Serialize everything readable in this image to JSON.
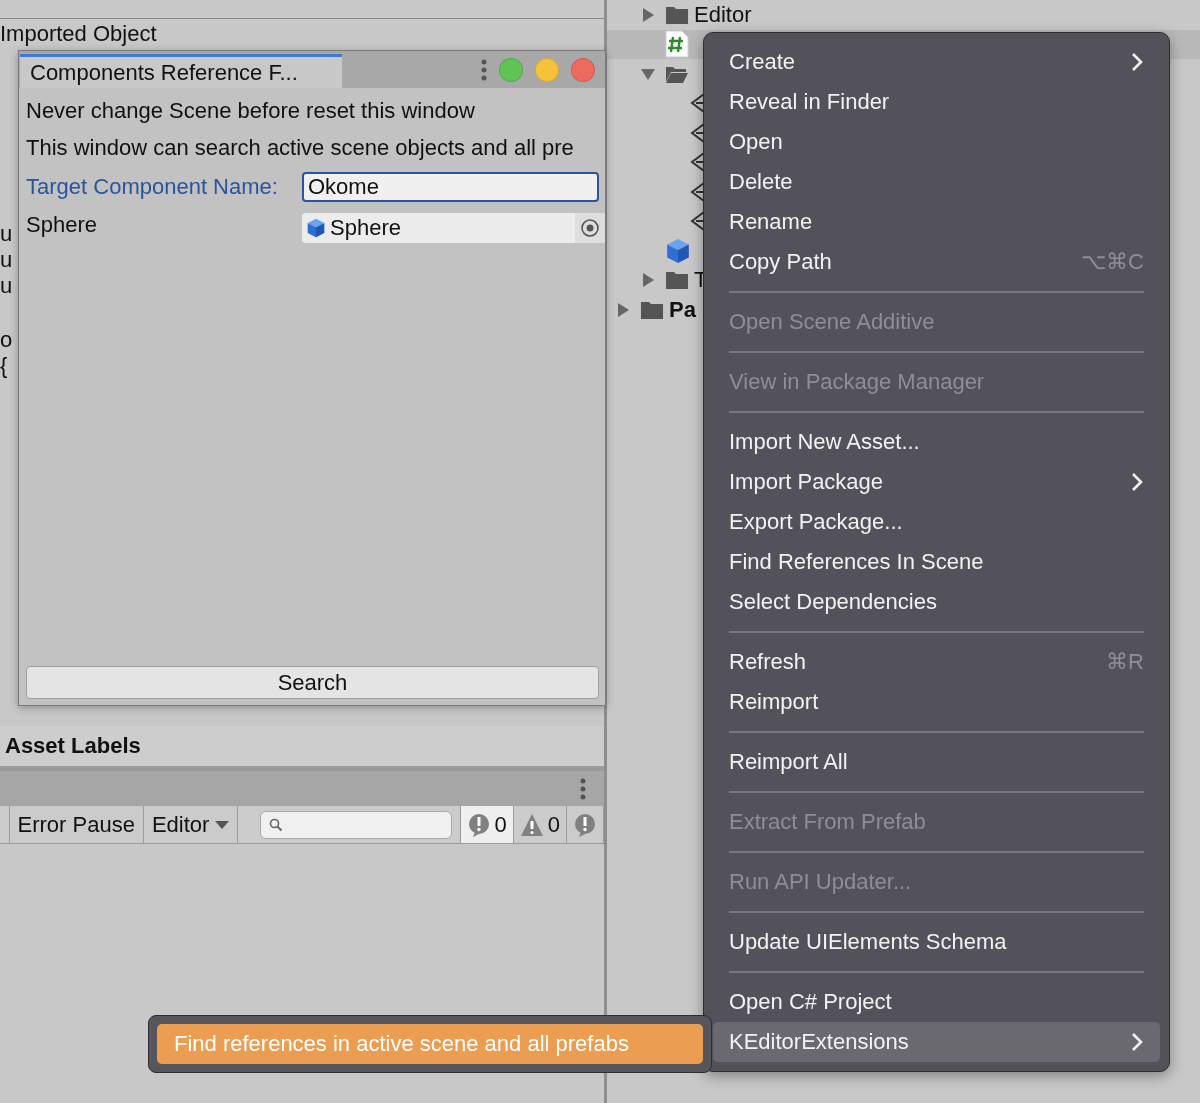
{
  "inspector": {
    "header": "Imported Object",
    "fragments": [
      "u",
      "u",
      "u",
      "o",
      "{"
    ]
  },
  "floating_window": {
    "tab": {
      "label": "Components Reference F...",
      "selected": true
    },
    "lines": [
      "Never change Scene before reset this window",
      "This window can search active scene objects and all pre"
    ],
    "target_field": {
      "label": "Target Component Name:",
      "value": "Okome",
      "focused": true
    },
    "object_field": {
      "label": "Sphere",
      "value": "Sphere"
    },
    "button": "Search"
  },
  "asset_labels": "Asset Labels",
  "console_toolbar": {
    "toggle": "Error Pause",
    "dropdown": "Editor",
    "counters": [
      {
        "kind": "error",
        "count": "0"
      },
      {
        "kind": "warning",
        "count": "0"
      },
      {
        "kind": "error"
      }
    ]
  },
  "project_tree": [
    {
      "kind": "folder",
      "label": "Editor",
      "expanded": false,
      "selected": false
    },
    {
      "kind": "script",
      "selected": true
    },
    {
      "kind": "folder",
      "expanded": true,
      "selected": false,
      "children": [
        {
          "kind": "prefab"
        },
        {
          "kind": "prefab"
        },
        {
          "kind": "prefab"
        },
        {
          "kind": "prefab"
        },
        {
          "kind": "prefab"
        }
      ]
    },
    {
      "kind": "model",
      "selected": false
    },
    {
      "kind": "folder",
      "label": "T",
      "expanded": false,
      "selected": false
    }
  ],
  "project_root": [
    {
      "kind": "folder",
      "label": "Pa",
      "expanded": false,
      "selected": false
    }
  ],
  "context_menu": [
    {
      "kind": "item",
      "label": "Create",
      "submenu": true,
      "disabled": false,
      "selected": false
    },
    {
      "kind": "item",
      "label": "Reveal in Finder",
      "submenu": false,
      "disabled": false,
      "selected": false
    },
    {
      "kind": "item",
      "label": "Open",
      "submenu": false,
      "disabled": false,
      "selected": false
    },
    {
      "kind": "item",
      "label": "Delete",
      "submenu": false,
      "disabled": false,
      "selected": false
    },
    {
      "kind": "item",
      "label": "Rename",
      "submenu": false,
      "disabled": false,
      "selected": false
    },
    {
      "kind": "item",
      "label": "Copy Path",
      "shortcut": "⌥⌘C",
      "submenu": false,
      "disabled": false,
      "selected": false
    },
    {
      "kind": "separator"
    },
    {
      "kind": "item",
      "label": "Open Scene Additive",
      "submenu": false,
      "disabled": true,
      "selected": false
    },
    {
      "kind": "separator"
    },
    {
      "kind": "item",
      "label": "View in Package Manager",
      "submenu": false,
      "disabled": true,
      "selected": false
    },
    {
      "kind": "separator"
    },
    {
      "kind": "item",
      "label": "Import New Asset...",
      "submenu": false,
      "disabled": false,
      "selected": false
    },
    {
      "kind": "item",
      "label": "Import Package",
      "submenu": true,
      "disabled": false,
      "selected": false
    },
    {
      "kind": "item",
      "label": "Export Package...",
      "submenu": false,
      "disabled": false,
      "selected": false
    },
    {
      "kind": "item",
      "label": "Find References In Scene",
      "submenu": false,
      "disabled": false,
      "selected": false
    },
    {
      "kind": "item",
      "label": "Select Dependencies",
      "submenu": false,
      "disabled": false,
      "selected": false
    },
    {
      "kind": "separator"
    },
    {
      "kind": "item",
      "label": "Refresh",
      "shortcut": "⌘R",
      "submenu": false,
      "disabled": false,
      "selected": false
    },
    {
      "kind": "item",
      "label": "Reimport",
      "submenu": false,
      "disabled": false,
      "selected": false
    },
    {
      "kind": "separator"
    },
    {
      "kind": "item",
      "label": "Reimport All",
      "submenu": false,
      "disabled": false,
      "selected": false
    },
    {
      "kind": "separator"
    },
    {
      "kind": "item",
      "label": "Extract From Prefab",
      "submenu": false,
      "disabled": true,
      "selected": false
    },
    {
      "kind": "separator"
    },
    {
      "kind": "item",
      "label": "Run API Updater...",
      "submenu": false,
      "disabled": true,
      "selected": false
    },
    {
      "kind": "separator"
    },
    {
      "kind": "item",
      "label": "Update UIElements Schema",
      "submenu": false,
      "disabled": false,
      "selected": false
    },
    {
      "kind": "separator"
    },
    {
      "kind": "item",
      "label": "Open C# Project",
      "submenu": false,
      "disabled": false,
      "selected": false
    },
    {
      "kind": "item",
      "label": "KEditorExtensions",
      "submenu": true,
      "disabled": false,
      "selected": true
    }
  ],
  "submenu": [
    {
      "label": "Find references in active scene and all prefabs",
      "selected": true
    }
  ]
}
